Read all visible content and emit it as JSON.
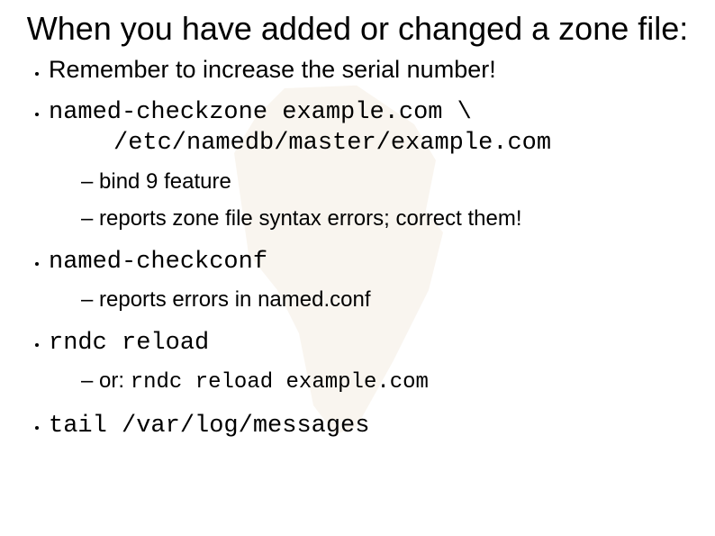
{
  "title": "When you have added or changed a zone file:",
  "bullets": {
    "b1": "Remember to increase the serial number!",
    "b2_line1": "named-checkzone example.com \\",
    "b2_line2": "/etc/namedb/master/example.com",
    "b2_sub1": "bind 9 feature",
    "b2_sub2": "reports zone file syntax errors; correct them!",
    "b3": "named-checkconf",
    "b3_sub1": "reports errors in named.conf",
    "b4": "rndc reload",
    "b4_sub1_prefix": "or: ",
    "b4_sub1_cmd": "rndc reload example.com",
    "b5": "tail /var/log/messages"
  }
}
